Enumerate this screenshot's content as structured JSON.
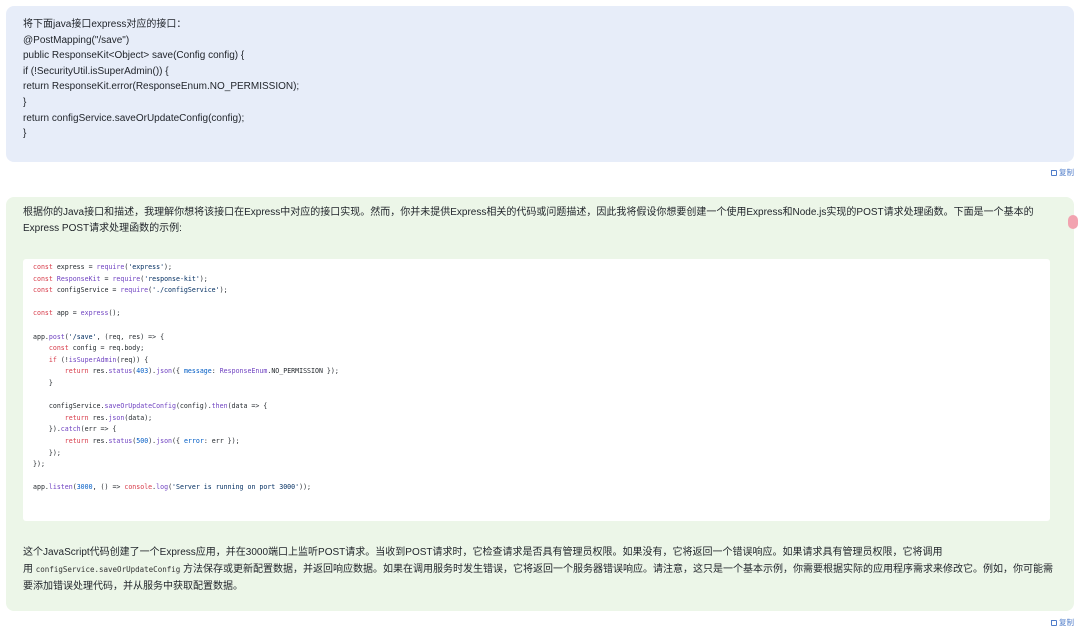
{
  "user_message": {
    "lines": [
      "将下面java接口express对应的接口：",
      "@PostMapping(\"/save\")",
      "public ResponseKit<Object> save(Config config) {",
      "if (!SecurityUtil.isSuperAdmin()) {",
      "return ResponseKit.error(ResponseEnum.NO_PERMISSION);",
      "}",
      "return configService.saveOrUpdateConfig(config);",
      "}"
    ],
    "copy_label": "复制"
  },
  "assistant_message": {
    "intro": "根据你的Java接口和描述，我理解你想将该接口在Express中对应的接口实现。然而，你并未提供Express相关的代码或问题描述，因此我将假设你想要创建一个使用Express和Node.js实现的POST请求处理函数。下面是一个基本的Express POST请求处理函数的示例:",
    "code_lines": [
      "const express = require('express');",
      "const ResponseKit = require('response-kit');",
      "const configService = require('./configService');",
      "",
      "const app = express();",
      "",
      "app.post('/save', (req, res) => {",
      "    const config = req.body;",
      "    if (!isSuperAdmin(req)) {",
      "        return res.status(403).json({ message: ResponseEnum.NO_PERMISSION });",
      "    }",
      "",
      "    configService.saveOrUpdateConfig(config).then(data => {",
      "        return res.json(data);",
      "    }).catch(err => {",
      "        return res.status(500).json({ error: err });",
      "    });",
      "});",
      "",
      "app.listen(3000, () => console.log('Server is running on port 3000'));"
    ],
    "outro_part1": "这个JavaScript代码创建了一个Express应用，并在3000端口上监听POST请求。当收到POST请求时，它检查请求是否具有管理员权限。如果没有，它将返回一个错误响应。如果请求具有管理员权限，它将调用",
    "outro_part2_prefix": "用 ",
    "outro_code": "configService.saveOrUpdateConfig",
    "outro_part3": " 方法保存或更新配置数据，并返回响应数据。如果在调用服务时发生错误，它将返回一个服务器错误响应。请注意，这只是一个基本示例，你需要根据实际的应用程序需求来修改它。例如，你可能需要添加错误处理代码，并从服务中获取配置数据。",
    "copy_label": "复制"
  },
  "colors": {
    "user_bubble": "#e7edf9",
    "assistant_bubble": "#ecf6e8",
    "link": "#4f7cc9"
  }
}
